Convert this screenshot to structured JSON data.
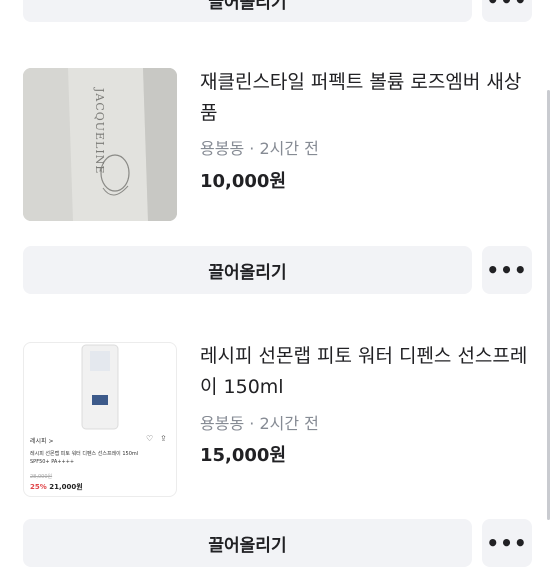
{
  "items": [
    {
      "title": "재클린스타일 퍼펙트 볼륨 로즈엠버 새상품",
      "location": "용봉동",
      "time": "2시간 전",
      "price": "10,000원",
      "thumb_brand_text": "JACQUELINE"
    },
    {
      "title": "레시피 선몬랩 피토 워터 디펜스 선스프레이 150ml",
      "location": "용봉동",
      "time": "2시간 전",
      "price": "15,000원",
      "thumb": {
        "seller": "레시피 >",
        "product_line1": "레시피 선몬랩 피토 워터 디펜스 선스프레이 150ml",
        "product_line2": "SPF50+ PA++++",
        "old_price": "28,000원",
        "discount": "25%",
        "sale_price": "21,000원"
      }
    }
  ],
  "bump_label": "끌어올리기",
  "more_label": "•••",
  "top_bump_label": "끌어올리기"
}
